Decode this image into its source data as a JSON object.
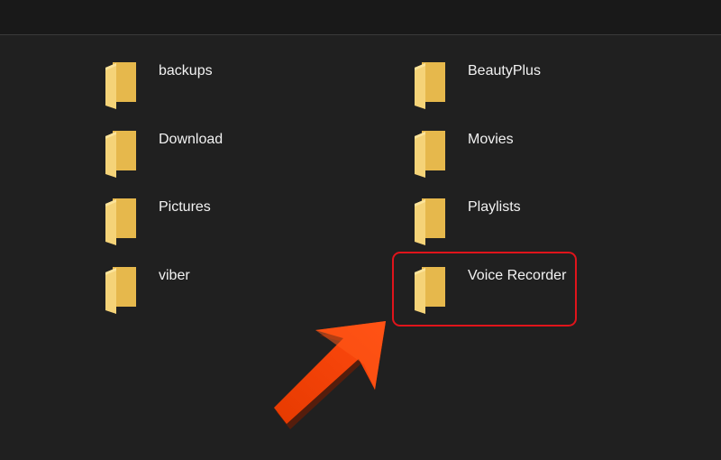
{
  "folders": [
    {
      "name": "backups"
    },
    {
      "name": "BeautyPlus"
    },
    {
      "name": "Download"
    },
    {
      "name": "Movies"
    },
    {
      "name": "Pictures"
    },
    {
      "name": "Playlists"
    },
    {
      "name": "viber"
    },
    {
      "name": "Voice Recorder"
    }
  ],
  "colors": {
    "background": "#202020",
    "folder_front": "#f5d378",
    "folder_back": "#e6b84c",
    "highlight": "#e0141b",
    "arrow": "#ff3d00"
  },
  "icons": {
    "folder": "folder-icon",
    "arrow": "arrow-pointer-icon"
  },
  "annotation": {
    "highlighted_folder": "Voice Recorder"
  }
}
